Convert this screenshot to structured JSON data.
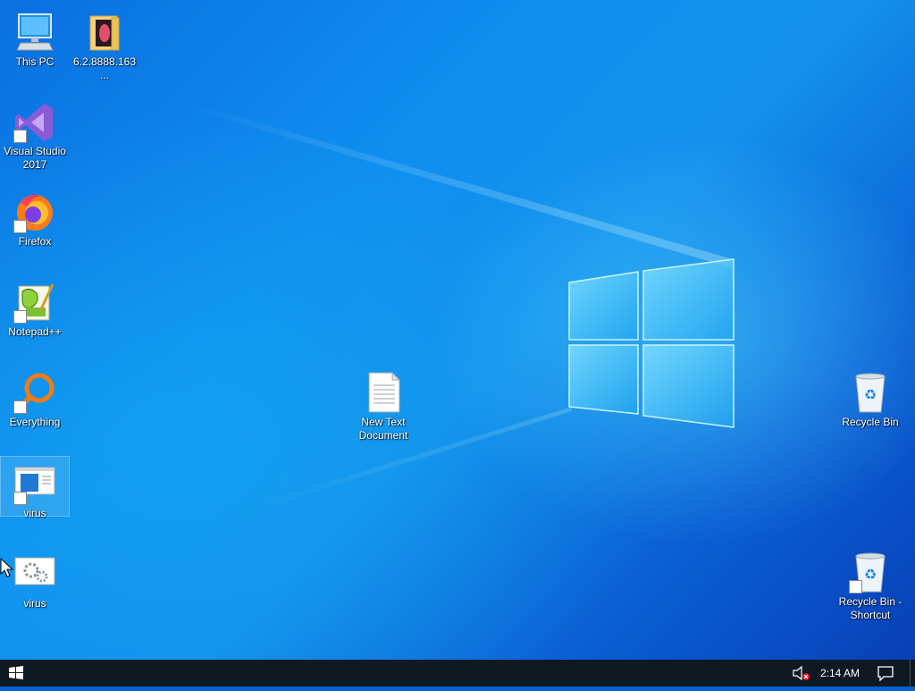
{
  "desktop": {
    "icons": [
      {
        "label": "This PC"
      },
      {
        "label": "6.2.8888.163..."
      },
      {
        "label": "Visual Studio 2017"
      },
      {
        "label": "Firefox"
      },
      {
        "label": "Notepad++"
      },
      {
        "label": "Everything"
      },
      {
        "label": "virus"
      },
      {
        "label": "virus"
      },
      {
        "label": "New Text Document"
      },
      {
        "label": "Recycle Bin"
      },
      {
        "label": "Recycle Bin - Shortcut"
      }
    ]
  },
  "taskbar": {
    "clock": "2:14 AM"
  },
  "colors": {
    "taskbar": "#101822",
    "accent": "#0078d7"
  }
}
